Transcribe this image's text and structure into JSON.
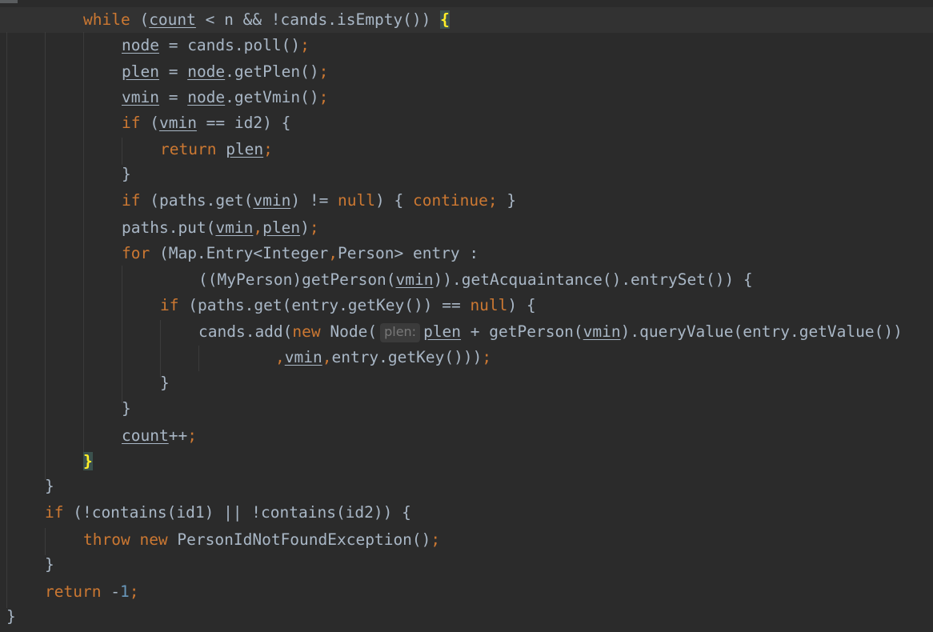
{
  "editor": {
    "lines": [
      {
        "tokens": [
          {
            "t": "while",
            "c": "kw"
          },
          {
            "t": " (",
            "c": "op"
          },
          {
            "t": "count",
            "c": "var"
          },
          {
            "t": " < n && !cands.isEmpty()) ",
            "c": "op"
          },
          {
            "t": "{",
            "c": "brace-match"
          }
        ]
      },
      {
        "tokens": [
          {
            "t": "node",
            "c": "var"
          },
          {
            "t": " = cands.poll()",
            "c": "op"
          },
          {
            "t": ";",
            "c": "punc"
          }
        ]
      },
      {
        "tokens": [
          {
            "t": "plen",
            "c": "var"
          },
          {
            "t": " = ",
            "c": "op"
          },
          {
            "t": "node",
            "c": "var"
          },
          {
            "t": ".getPlen()",
            "c": "op"
          },
          {
            "t": ";",
            "c": "punc"
          }
        ]
      },
      {
        "tokens": [
          {
            "t": "vmin",
            "c": "var"
          },
          {
            "t": " = ",
            "c": "op"
          },
          {
            "t": "node",
            "c": "var"
          },
          {
            "t": ".getVmin()",
            "c": "op"
          },
          {
            "t": ";",
            "c": "punc"
          }
        ]
      },
      {
        "tokens": [
          {
            "t": "if",
            "c": "kw"
          },
          {
            "t": " (",
            "c": "op"
          },
          {
            "t": "vmin",
            "c": "var"
          },
          {
            "t": " == id2) {",
            "c": "op"
          }
        ]
      },
      {
        "tokens": [
          {
            "t": "return",
            "c": "kw"
          },
          {
            "t": " ",
            "c": "op"
          },
          {
            "t": "plen",
            "c": "var"
          },
          {
            "t": ";",
            "c": "punc"
          }
        ]
      },
      {
        "tokens": [
          {
            "t": "}",
            "c": "op"
          }
        ]
      },
      {
        "tokens": [
          {
            "t": "if",
            "c": "kw"
          },
          {
            "t": " (paths.get(",
            "c": "op"
          },
          {
            "t": "vmin",
            "c": "var"
          },
          {
            "t": ") != ",
            "c": "op"
          },
          {
            "t": "null",
            "c": "kw"
          },
          {
            "t": ") { ",
            "c": "op"
          },
          {
            "t": "continue;",
            "c": "kw"
          },
          {
            "t": " }",
            "c": "op"
          }
        ]
      },
      {
        "tokens": [
          {
            "t": "paths.put(",
            "c": "op"
          },
          {
            "t": "vmin",
            "c": "var"
          },
          {
            "t": ",",
            "c": "punc"
          },
          {
            "t": "plen",
            "c": "var"
          },
          {
            "t": ")",
            "c": "op"
          },
          {
            "t": ";",
            "c": "punc"
          }
        ]
      },
      {
        "tokens": [
          {
            "t": "for",
            "c": "kw"
          },
          {
            "t": " (Map.Entry<Integer",
            "c": "op"
          },
          {
            "t": ",",
            "c": "punc"
          },
          {
            "t": "Person> entry :",
            "c": "op"
          }
        ]
      },
      {
        "tokens": [
          {
            "t": "((MyPerson)getPerson(",
            "c": "op"
          },
          {
            "t": "vmin",
            "c": "var"
          },
          {
            "t": ")).getAcquaintance().entrySet()) {",
            "c": "op"
          }
        ]
      },
      {
        "tokens": [
          {
            "t": "if",
            "c": "kw"
          },
          {
            "t": " (paths.get(entry.getKey()) == ",
            "c": "op"
          },
          {
            "t": "null",
            "c": "kw"
          },
          {
            "t": ") {",
            "c": "op"
          }
        ]
      },
      {
        "tokens": [
          {
            "t": "cands.add(",
            "c": "op"
          },
          {
            "t": "new",
            "c": "kw"
          },
          {
            "t": " Node(",
            "c": "op"
          },
          {
            "t": "plen:",
            "c": "hint"
          },
          {
            "t": "plen",
            "c": "var"
          },
          {
            "t": " + getPerson(",
            "c": "op"
          },
          {
            "t": "vmin",
            "c": "var"
          },
          {
            "t": ").queryValue(entry.getValue())",
            "c": "op"
          }
        ]
      },
      {
        "tokens": [
          {
            "t": ",",
            "c": "punc"
          },
          {
            "t": "vmin",
            "c": "var"
          },
          {
            "t": ",",
            "c": "punc"
          },
          {
            "t": "entry.getKey()))",
            "c": "op"
          },
          {
            "t": ";",
            "c": "punc"
          }
        ]
      },
      {
        "tokens": [
          {
            "t": "}",
            "c": "op"
          }
        ]
      },
      {
        "tokens": [
          {
            "t": "}",
            "c": "op"
          }
        ]
      },
      {
        "tokens": [
          {
            "t": "count",
            "c": "var"
          },
          {
            "t": "++",
            "c": "op"
          },
          {
            "t": ";",
            "c": "punc"
          }
        ]
      },
      {
        "tokens": [
          {
            "t": "}",
            "c": "brace-match"
          }
        ]
      },
      {
        "tokens": [
          {
            "t": "}",
            "c": "op"
          }
        ]
      },
      {
        "tokens": [
          {
            "t": "if",
            "c": "kw"
          },
          {
            "t": " (!contains(id1) || !contains(id2)) {",
            "c": "op"
          }
        ]
      },
      {
        "tokens": [
          {
            "t": "throw",
            "c": "kw"
          },
          {
            "t": " ",
            "c": "op"
          },
          {
            "t": "new",
            "c": "kw"
          },
          {
            "t": " PersonIdNotFoundException()",
            "c": "op"
          },
          {
            "t": ";",
            "c": "punc"
          }
        ]
      },
      {
        "tokens": [
          {
            "t": "}",
            "c": "op"
          }
        ]
      },
      {
        "tokens": [
          {
            "t": "return",
            "c": "kw"
          },
          {
            "t": " -",
            "c": "op"
          },
          {
            "t": "1",
            "c": "num"
          },
          {
            "t": ";",
            "c": "punc"
          }
        ]
      },
      {
        "tokens": [
          {
            "t": "}",
            "c": "op"
          }
        ]
      }
    ]
  },
  "theme": {
    "background": "#2b2b2b",
    "current_line": "#323232",
    "keyword": "#cc7832",
    "text": "#a9b7c6",
    "number": "#6897bb",
    "brace_match_bg": "#3b514d",
    "brace_match_fg": "#ffef28",
    "inlay_hint_bg": "#3b3b3b",
    "inlay_hint_fg": "#787878"
  }
}
